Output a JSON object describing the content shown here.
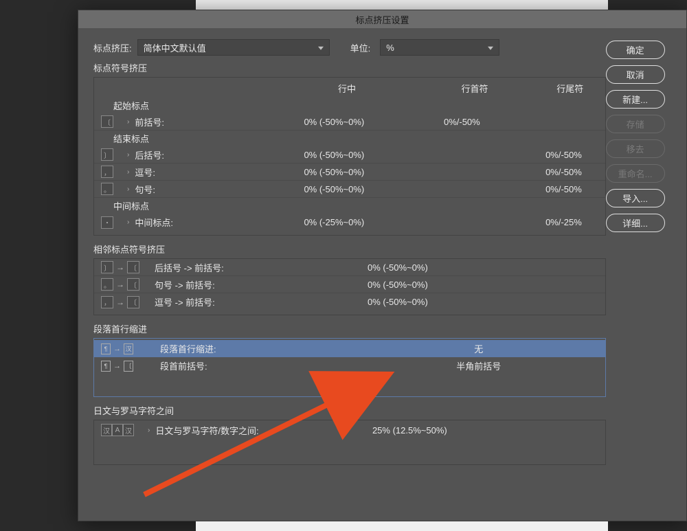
{
  "dialog": {
    "title": "标点挤压设置",
    "preset_label": "标点挤压:",
    "preset_value": "简体中文默认值",
    "unit_label": "单位:",
    "unit_value": "%"
  },
  "section1": {
    "title": "标点符号挤压",
    "header_mid": "行中",
    "header_start": "行首符",
    "header_end": "行尾符",
    "group_open": "起始标点",
    "open_label": "前括号:",
    "open_mid": "0% (-50%~0%)",
    "open_start": "0%/-50%",
    "group_close": "结束标点",
    "close_label": "后括号:",
    "close_mid": "0% (-50%~0%)",
    "close_end": "0%/-50%",
    "comma_label": "逗号:",
    "comma_mid": "0% (-50%~0%)",
    "comma_end": "0%/-50%",
    "period_label": "句号:",
    "period_mid": "0% (-50%~0%)",
    "period_end": "0%/-50%",
    "group_mid": "中间标点",
    "midpt_label": "中间标点:",
    "midpt_mid": "0% (-25%~0%)",
    "midpt_end": "0%/-25%"
  },
  "section2": {
    "title": "相邻标点符号挤压",
    "r1_label": "后括号 -> 前括号:",
    "r1_value": "0% (-50%~0%)",
    "r2_label": "句号 -> 前括号:",
    "r2_value": "0% (-50%~0%)",
    "r3_label": "逗号 -> 前括号:",
    "r3_value": "0% (-50%~0%)"
  },
  "section3": {
    "title": "段落首行缩进",
    "r1_label": "段落首行缩进:",
    "r1_value": "无",
    "r2_label": "段首前括号:",
    "r2_value": "半角前括号"
  },
  "section4": {
    "title": "日文与罗马字符之间",
    "r1_label": "日文与罗马字符/数字之间:",
    "r1_value": "25% (12.5%~50%)"
  },
  "buttons": {
    "ok": "确定",
    "cancel": "取消",
    "new": "新建...",
    "save": "存储",
    "remove": "移去",
    "rename": "重命名...",
    "import": "导入...",
    "detail": "详细..."
  }
}
